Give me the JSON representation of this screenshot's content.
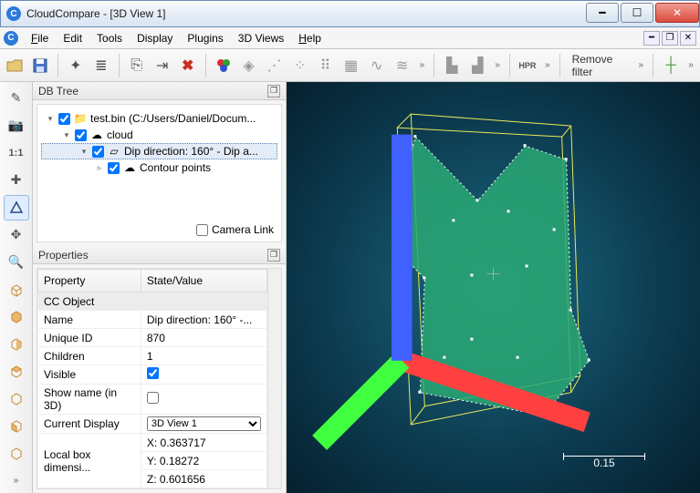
{
  "window": {
    "title": "CloudCompare - [3D View 1]"
  },
  "menu": {
    "file": "File",
    "edit": "Edit",
    "tools": "Tools",
    "display": "Display",
    "plugins": "Plugins",
    "views3d": "3D Views",
    "help": "Help"
  },
  "toolbar": {
    "open": "open",
    "save": "save",
    "pick": "pick",
    "list": "list",
    "clone": "clone",
    "merge": "merge",
    "delete": "delete",
    "colors": "colors",
    "normals": "normals",
    "resample1": "resample1",
    "resample2": "resample2",
    "resample3": "resample3",
    "octree": "octree",
    "stats": "stats",
    "hist": "hist",
    "chev1": "»",
    "bar2a": "bar2a",
    "bar2b": "bar2b",
    "chev2": "»",
    "hpr": "HPR",
    "chev3": "»",
    "remove_filter": "Remove filter",
    "chev4": "»",
    "cross": "cross",
    "chev5": "»"
  },
  "leftbar": {
    "pick": "pick",
    "camera": "camera",
    "oneone": "1:1",
    "plus": "plus",
    "persp": "persp",
    "move": "move",
    "zoom": "zoom",
    "box1": "box1",
    "box2": "box2",
    "box3": "box3",
    "box4": "box4",
    "box5": "box5",
    "box6": "box6",
    "box7": "box7",
    "chev": "»"
  },
  "dbtree": {
    "title": "DB Tree",
    "root": "test.bin (C:/Users/Daniel/Docum...",
    "cloud": "cloud",
    "dip": "Dip direction: 160° - Dip a...",
    "contour": "Contour points",
    "camera_link": "Camera Link"
  },
  "properties": {
    "title": "Properties",
    "col_property": "Property",
    "col_state": "State/Value",
    "group": "CC Object",
    "rows": {
      "name_k": "Name",
      "name_v": "Dip direction: 160° -...",
      "uid_k": "Unique ID",
      "uid_v": "870",
      "children_k": "Children",
      "children_v": "1",
      "visible_k": "Visible",
      "showname_k": "Show name (in 3D)",
      "display_k": "Current Display",
      "display_v": "3D View 1",
      "box_k": "Local box dimensi...",
      "box_x": "X: 0.363717",
      "box_y": "Y: 0.18272",
      "box_z": "Z: 0.601656"
    }
  },
  "viewport": {
    "scale_label": "0.15"
  }
}
